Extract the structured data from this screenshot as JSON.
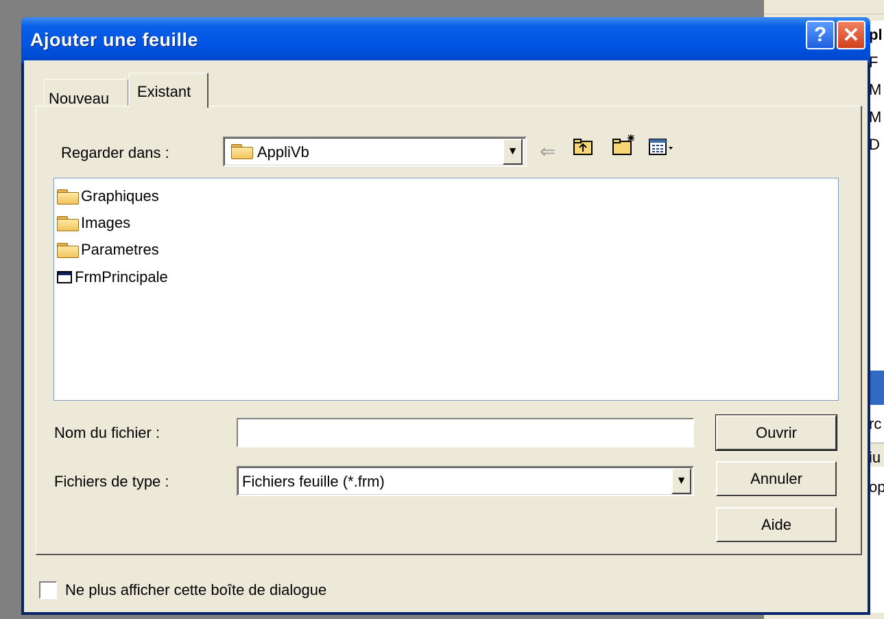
{
  "window": {
    "title": "Ajouter une feuille",
    "help_glyph": "?",
    "close_glyph": "✕"
  },
  "tabs": [
    {
      "label": "Nouveau",
      "selected": false
    },
    {
      "label": "Existant",
      "selected": true
    }
  ],
  "look_in": {
    "label": "Regarder dans :",
    "value": "AppliVb"
  },
  "toolbar": {
    "back_icon": "back-arrow-icon",
    "up_icon": "folder-up-icon",
    "new_folder_icon": "new-folder-icon",
    "view_icon": "view-menu-icon"
  },
  "file_list": [
    {
      "name": "Graphiques",
      "icon": "folder-icon"
    },
    {
      "name": "Images",
      "icon": "folder-icon"
    },
    {
      "name": "Parametres",
      "icon": "folder-icon"
    },
    {
      "name": "FrmPrincipale",
      "icon": "form-file-icon"
    }
  ],
  "file_name": {
    "label": "Nom du fichier :",
    "value": ""
  },
  "file_type": {
    "label": "Fichiers de type :",
    "value": "Fichiers feuille (*.frm)"
  },
  "buttons": {
    "open": "Ouvrir",
    "cancel": "Annuler",
    "help": "Aide"
  },
  "checkbox": {
    "label": "Ne plus afficher cette boîte de dialogue",
    "checked": false
  },
  "background": {
    "lines": [
      "pl",
      "F",
      "M",
      "M",
      "D",
      "rc",
      "iu",
      "op"
    ]
  }
}
